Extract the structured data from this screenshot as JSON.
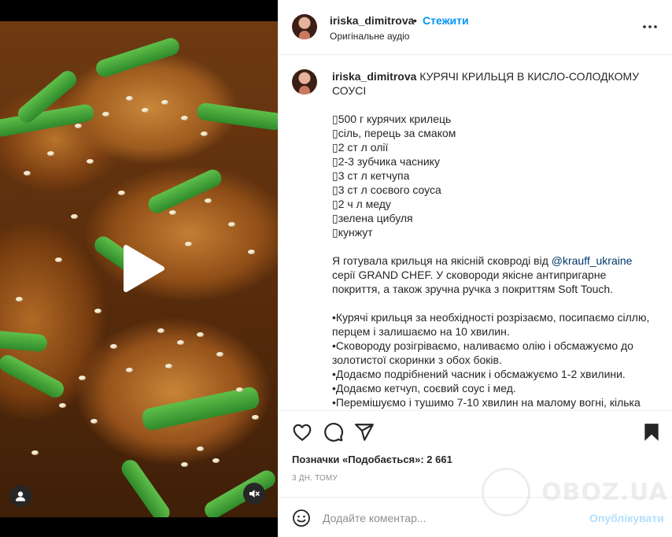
{
  "post": {
    "username": "iriska_dimitrova",
    "separator": "•",
    "follow_label": "Стежити",
    "audio_label": "Оригінальне аудіо"
  },
  "caption": {
    "username": "iriska_dimitrova",
    "title": "КУРЯЧІ КРИЛЬЦЯ В КИСЛО-СОЛОДКОМУ СОУСІ",
    "ingredients": [
      "▯500 г курячих крилець",
      "▯сіль, перець за смаком",
      "▯2 ст л олії",
      "▯2-3 зубчика часнику",
      "▯3 ст л кетчупа",
      "▯3 ст л соєвого соуса",
      "▯2 ч л меду",
      "▯зелена цибуля",
      "▯кунжут"
    ],
    "intro_before_link": "Я готувала крильця на якісній сковроді від ",
    "intro_link": "@krauff_ukraine",
    "intro_after_link": " серії GRAND CHEF. У сковороди якісне антипригарне покриття, а також зручна ручка з покриттям Soft Touch.",
    "steps": [
      "•Курячі крильця за необхідності розрізаємо, посипаємо сіллю, перцем і залишаємо на 10 хвилин.",
      "•Сковороду розігріваємо, наливаємо олію і обсмажуємо до золотистої скоринки з обох боків.",
      "•Додаємо подрібнений часник і обсмажуємо 1-2 хвилини.",
      "•Додаємо кетчуп, соєвий соус і мед.",
      "•Перемішуємо і тушимо 7-10 хвилин на малому вогні, кілька"
    ]
  },
  "stats": {
    "likes_label": "Позначки «Подобається»: 2 661",
    "time_ago": "3 ДН. ТОМУ"
  },
  "comment": {
    "placeholder": "Додайте коментар...",
    "publish_label": "Опублікувати"
  },
  "watermark": {
    "text": "OBOZ.UA"
  },
  "icons": {
    "media": [
      "play-icon",
      "user-icon",
      "mute-icon"
    ],
    "actions": [
      "heart-icon",
      "comment-icon",
      "share-icon",
      "bookmark-icon"
    ],
    "header": [
      "more-icon"
    ],
    "comment": [
      "emoji-icon"
    ]
  },
  "colors": {
    "accent": "#0095f6",
    "link": "#00376b",
    "publish_disabled": "#b2dffc",
    "muted": "#8e8e8e"
  }
}
